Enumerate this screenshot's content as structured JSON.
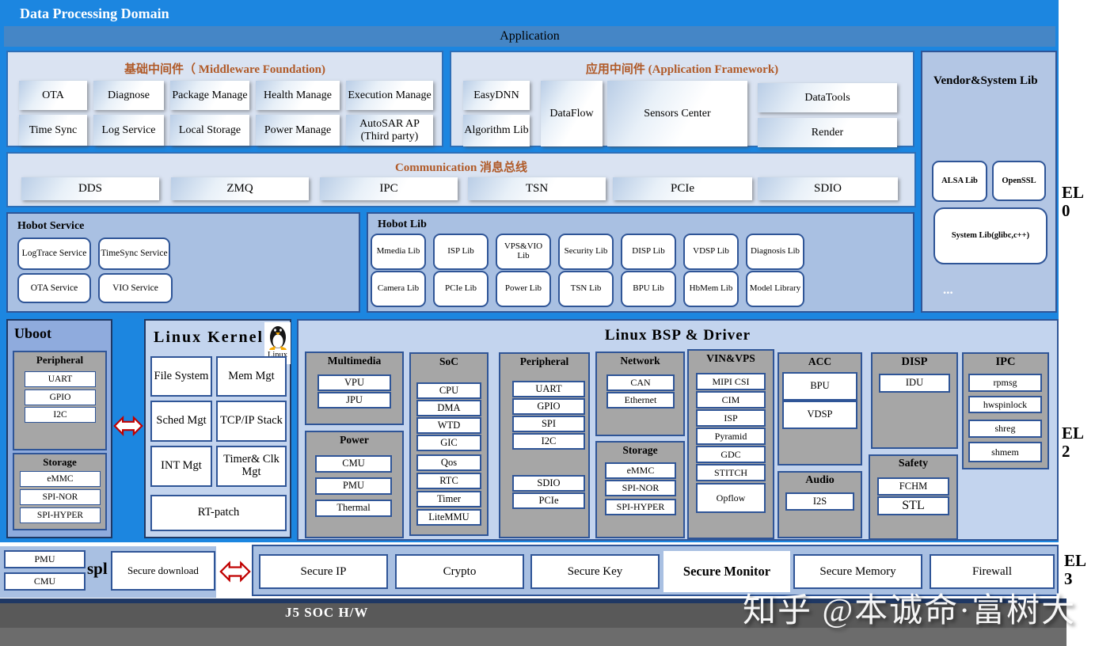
{
  "header": {
    "title": "Data Processing Domain",
    "application": "Application"
  },
  "middleware_foundation": {
    "title": "基础中间件（ Middleware Foundation)",
    "row1": [
      "OTA",
      "Diagnose",
      "Package Manage",
      "Health Manage",
      "Execution Manage"
    ],
    "row2": [
      "Time Sync",
      "Log Service",
      "Local Storage",
      "Power Manage",
      "AutoSAR AP (Third party)"
    ]
  },
  "application_framework": {
    "title": "应用中间件 (Application Framework)",
    "easydnn": "EasyDNN",
    "algorithm_lib": "Algorithm Lib",
    "dataflow": "DataFlow",
    "sensors_center": "Sensors Center",
    "datatools": "DataTools",
    "render": "Render"
  },
  "vendor_system_lib": {
    "title": "Vendor&System Lib",
    "alsa": "ALSA Lib",
    "openssl": "OpenSSL",
    "system_lib": "System Lib(glibc,c++)",
    "more": "..."
  },
  "communication": {
    "title": "Communication 消息总线",
    "buses": [
      "DDS",
      "ZMQ",
      "IPC",
      "TSN",
      "PCIe",
      "SDIO"
    ]
  },
  "hobot_service": {
    "title": "Hobot Service",
    "row1": [
      "LogTrace Service",
      "TimeSync Service"
    ],
    "row2": [
      "OTA Service",
      "VIO Service"
    ]
  },
  "hobot_lib": {
    "title": "Hobot Lib",
    "row1": [
      "Mmedia Lib",
      "ISP Lib",
      "VPS&VIO Lib",
      "Security Lib",
      "DISP Lib",
      "VDSP Lib",
      "Diagnosis Lib"
    ],
    "row2": [
      "Camera Lib",
      "PCIe Lib",
      "Power Lib",
      "TSN Lib",
      "BPU Lib",
      "HbMem Lib",
      "Model Library"
    ]
  },
  "privilege": {
    "el0": [
      "EL",
      "0"
    ],
    "el2": [
      "EL",
      "2"
    ],
    "el3": [
      "EL",
      "3"
    ]
  },
  "uboot": {
    "title": "Uboot",
    "peripheral_title": "Peripheral",
    "peripheral": [
      "UART",
      "GPIO",
      "I2C"
    ],
    "storage_title": "Storage",
    "storage": [
      "eMMC",
      "SPI-NOR",
      "SPI-HYPER"
    ]
  },
  "linux_kernel": {
    "title": "Linux Kernel",
    "logo": "Linux",
    "boxes": [
      "File System",
      "Mem Mgt",
      "Sched Mgt",
      "TCP/IP Stack",
      "INT Mgt",
      "Timer& Clk Mgt",
      "RT-patch"
    ]
  },
  "bsp": {
    "title": "Linux BSP & Driver",
    "multimedia": {
      "title": "Multimedia",
      "items": [
        "VPU",
        "JPU"
      ]
    },
    "power": {
      "title": "Power",
      "items": [
        "CMU",
        "PMU",
        "Thermal"
      ]
    },
    "soc": {
      "title": "SoC",
      "items": [
        "CPU",
        "DMA",
        "WTD",
        "GIC",
        "Qos",
        "RTC",
        "Timer",
        "LiteMMU"
      ]
    },
    "peripheral": {
      "title": "Peripheral",
      "items": [
        "UART",
        "GPIO",
        "SPI",
        "I2C"
      ],
      "items2": [
        "SDIO",
        "PCIe"
      ]
    },
    "network": {
      "title": "Network",
      "items": [
        "CAN",
        "Ethernet"
      ]
    },
    "storage": {
      "title": "Storage",
      "items": [
        "eMMC",
        "SPI-NOR",
        "SPI-HYPER"
      ]
    },
    "vin_vps": {
      "title": "VIN&VPS",
      "items": [
        "MIPI CSI",
        "CIM",
        "ISP",
        "Pyramid",
        "GDC",
        "STITCH",
        "Opflow"
      ]
    },
    "acc": {
      "title": "ACC",
      "items": [
        "BPU",
        "VDSP"
      ]
    },
    "audio": {
      "title": "Audio",
      "items": [
        "I2S"
      ]
    },
    "disp": {
      "title": "DISP",
      "items": [
        "IDU"
      ]
    },
    "safety": {
      "title": "Safety",
      "items": [
        "FCHM",
        "STL"
      ]
    },
    "ipc": {
      "title": "IPC",
      "items": [
        "rpmsg",
        "hwspinlock",
        "shreg",
        "shmem"
      ]
    }
  },
  "secure_boot": {
    "pmu": "PMU",
    "cmu": "CMU",
    "spl": "spl",
    "secure_download": "Secure download"
  },
  "secure_row": [
    "Secure IP",
    "Crypto",
    "Secure Key",
    "Secure Monitor",
    "Secure Memory",
    "Firewall"
  ],
  "hardware": "J5 SOC H/W",
  "watermark": "知乎 @本诚命·富树大",
  "colors": {
    "background_blue": "#1c86e0",
    "app_bar_blue": "#4586c6",
    "panel_light": "#dae3f2",
    "panel_periwinkle": "#a9c0e2",
    "panel_medium": "#8fabdd",
    "gray_block": "#a6a6a6",
    "accent_orange": "#b05a28",
    "border_dark": "#2f5597",
    "hw_bar_gray": "#595959"
  }
}
